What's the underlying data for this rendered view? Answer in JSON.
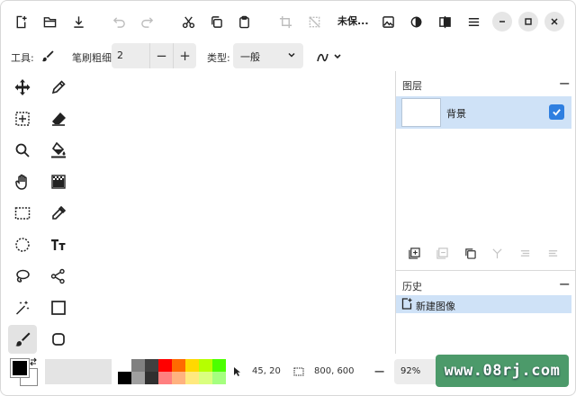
{
  "title": "未保...",
  "options_bar": {
    "tool_label": "工具:",
    "brush_size_label": "笔刷粗细:",
    "brush_size_value": "2",
    "minus_label": "−",
    "plus_label": "+",
    "type_label": "类型:",
    "type_value": "一般"
  },
  "tools": [
    "move-icon",
    "pencil-icon",
    "ellipse-icon",
    "move-selection-icon",
    "eraser-icon",
    "freeform-shape-icon",
    "zoom-icon",
    "paint-bucket-icon",
    "clone-stamp-icon",
    "pan-icon",
    "gradient-icon",
    "recolor-icon",
    "rectangle-select-icon",
    "color-picker-icon",
    "ellipse-select-icon",
    "text-icon",
    "lasso-select-icon",
    "line-curve-icon",
    "magic-wand-icon",
    "rectangle-icon",
    "paintbrush-icon",
    "rounded-rectangle-icon"
  ],
  "layers": {
    "header": "图层",
    "items": [
      {
        "name": "背景",
        "visible": true
      }
    ]
  },
  "history": {
    "header": "历史",
    "items": [
      {
        "label": "新建图像"
      }
    ]
  },
  "palette": {
    "primary": "#000000",
    "secondary": "#ffffff",
    "colors": [
      "#ffffff",
      "#808080",
      "#404040",
      "#ff0000",
      "#ff6a00",
      "#ffd800",
      "#b6ff00",
      "#4cff00",
      "#000000",
      "#a0a0a0",
      "#303030",
      "#ff7f7f",
      "#ffb27f",
      "#ffe97f",
      "#daff7f",
      "#a5ff7f"
    ]
  },
  "status": {
    "cursor_position": "45, 20",
    "selection_size": "800, 600",
    "zoom_minus": "−",
    "zoom": "92%"
  },
  "watermark": "www.08rj.com",
  "colors": {
    "accent": "#2f7fe0",
    "selected_row": "#cfe2f7"
  }
}
